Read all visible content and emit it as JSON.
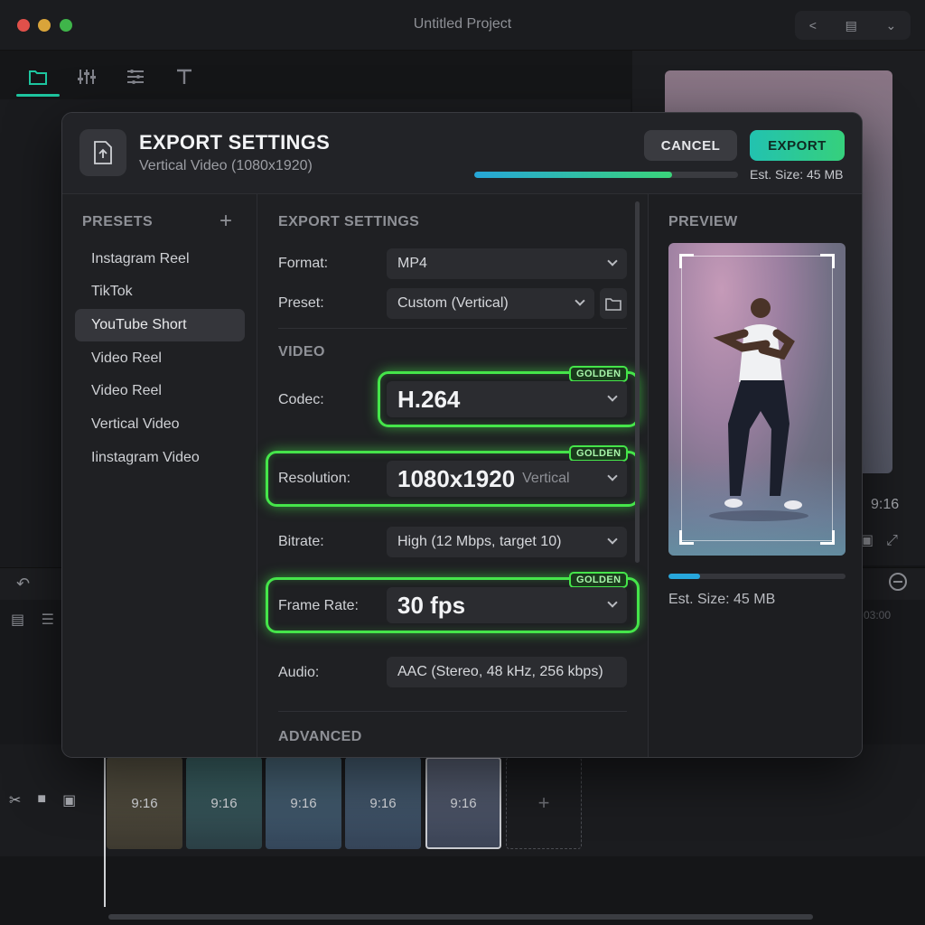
{
  "app": {
    "title": "Untitled Project",
    "background_preview_ratio": "9:16",
    "timeline_time": "03:00",
    "clips": [
      "9:16",
      "9:16",
      "9:16",
      "9:16",
      "9:16"
    ],
    "add_clip_symbol": "+"
  },
  "modal": {
    "title": "EXPORT SETTINGS",
    "subtitle": "Vertical Video (1080x1920)",
    "cancel_label": "CANCEL",
    "export_label": "EXPORT",
    "export_progress_percent": 75,
    "est_size": "Est. Size: 45 MB"
  },
  "presets": {
    "heading": "PRESETS",
    "add_symbol": "+",
    "selected_index": 2,
    "items": [
      "Instagram Reel",
      "TikTok",
      "YouTube Short",
      "Video Reel",
      "Video Reel",
      "Vertical Video",
      "Iinstagram Video"
    ]
  },
  "settings": {
    "heading": "EXPORT SETTINGS",
    "format": {
      "label": "Format:",
      "value": "MP4"
    },
    "preset": {
      "label": "Preset:",
      "value": "Custom (Vertical)"
    },
    "video_heading": "VIDEO",
    "codec": {
      "label": "Codec:",
      "value": "H.264",
      "tag": "GOLDEN"
    },
    "resolution": {
      "label": "Resolution:",
      "value": "1080x1920",
      "sub": "Vertical",
      "tag": "GOLDEN"
    },
    "bitrate": {
      "label": "Bitrate:",
      "value": "High (12 Mbps, target 10)"
    },
    "frame_rate": {
      "label": "Frame Rate:",
      "value": "30 fps",
      "tag": "GOLDEN"
    },
    "audio": {
      "label": "Audio:",
      "value": "AAC (Stereo, 48 kHz, 256 kbps)"
    },
    "advanced_heading": "ADVANCED"
  },
  "preview": {
    "heading": "PREVIEW",
    "progress_percent": 18,
    "est_size": "Est. Size: 45 MB"
  },
  "colors": {
    "accent_teal": "#22c2b0",
    "accent_green": "#36d07c",
    "golden_highlight": "#45e54a",
    "progress_blue": "#27a7dc"
  }
}
